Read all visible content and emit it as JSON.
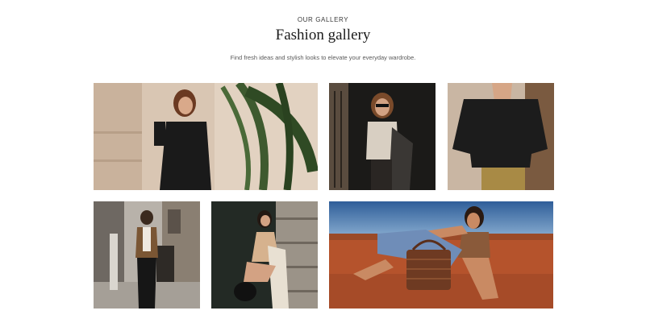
{
  "section": {
    "eyebrow": "OUR GALLERY",
    "title": "Fashion gallery",
    "subtitle": "Find fresh ideas and stylish looks to elevate your everyday wardrobe."
  },
  "gallery": {
    "images": [
      {
        "name": "woman-black-button-dress-with-palm-leaves"
      },
      {
        "name": "woman-sunglasses-cardigan-lace-up-top"
      },
      {
        "name": "black-button-shirt-on-model"
      },
      {
        "name": "street-style-vest-wide-trousers"
      },
      {
        "name": "woman-crouching-by-stone-wall"
      },
      {
        "name": "woman-jeans-woven-bag-desert"
      }
    ]
  },
  "colors": {
    "background": "#ffffff",
    "title": "#1c1c1c",
    "subtitle": "#5a5a5a"
  }
}
